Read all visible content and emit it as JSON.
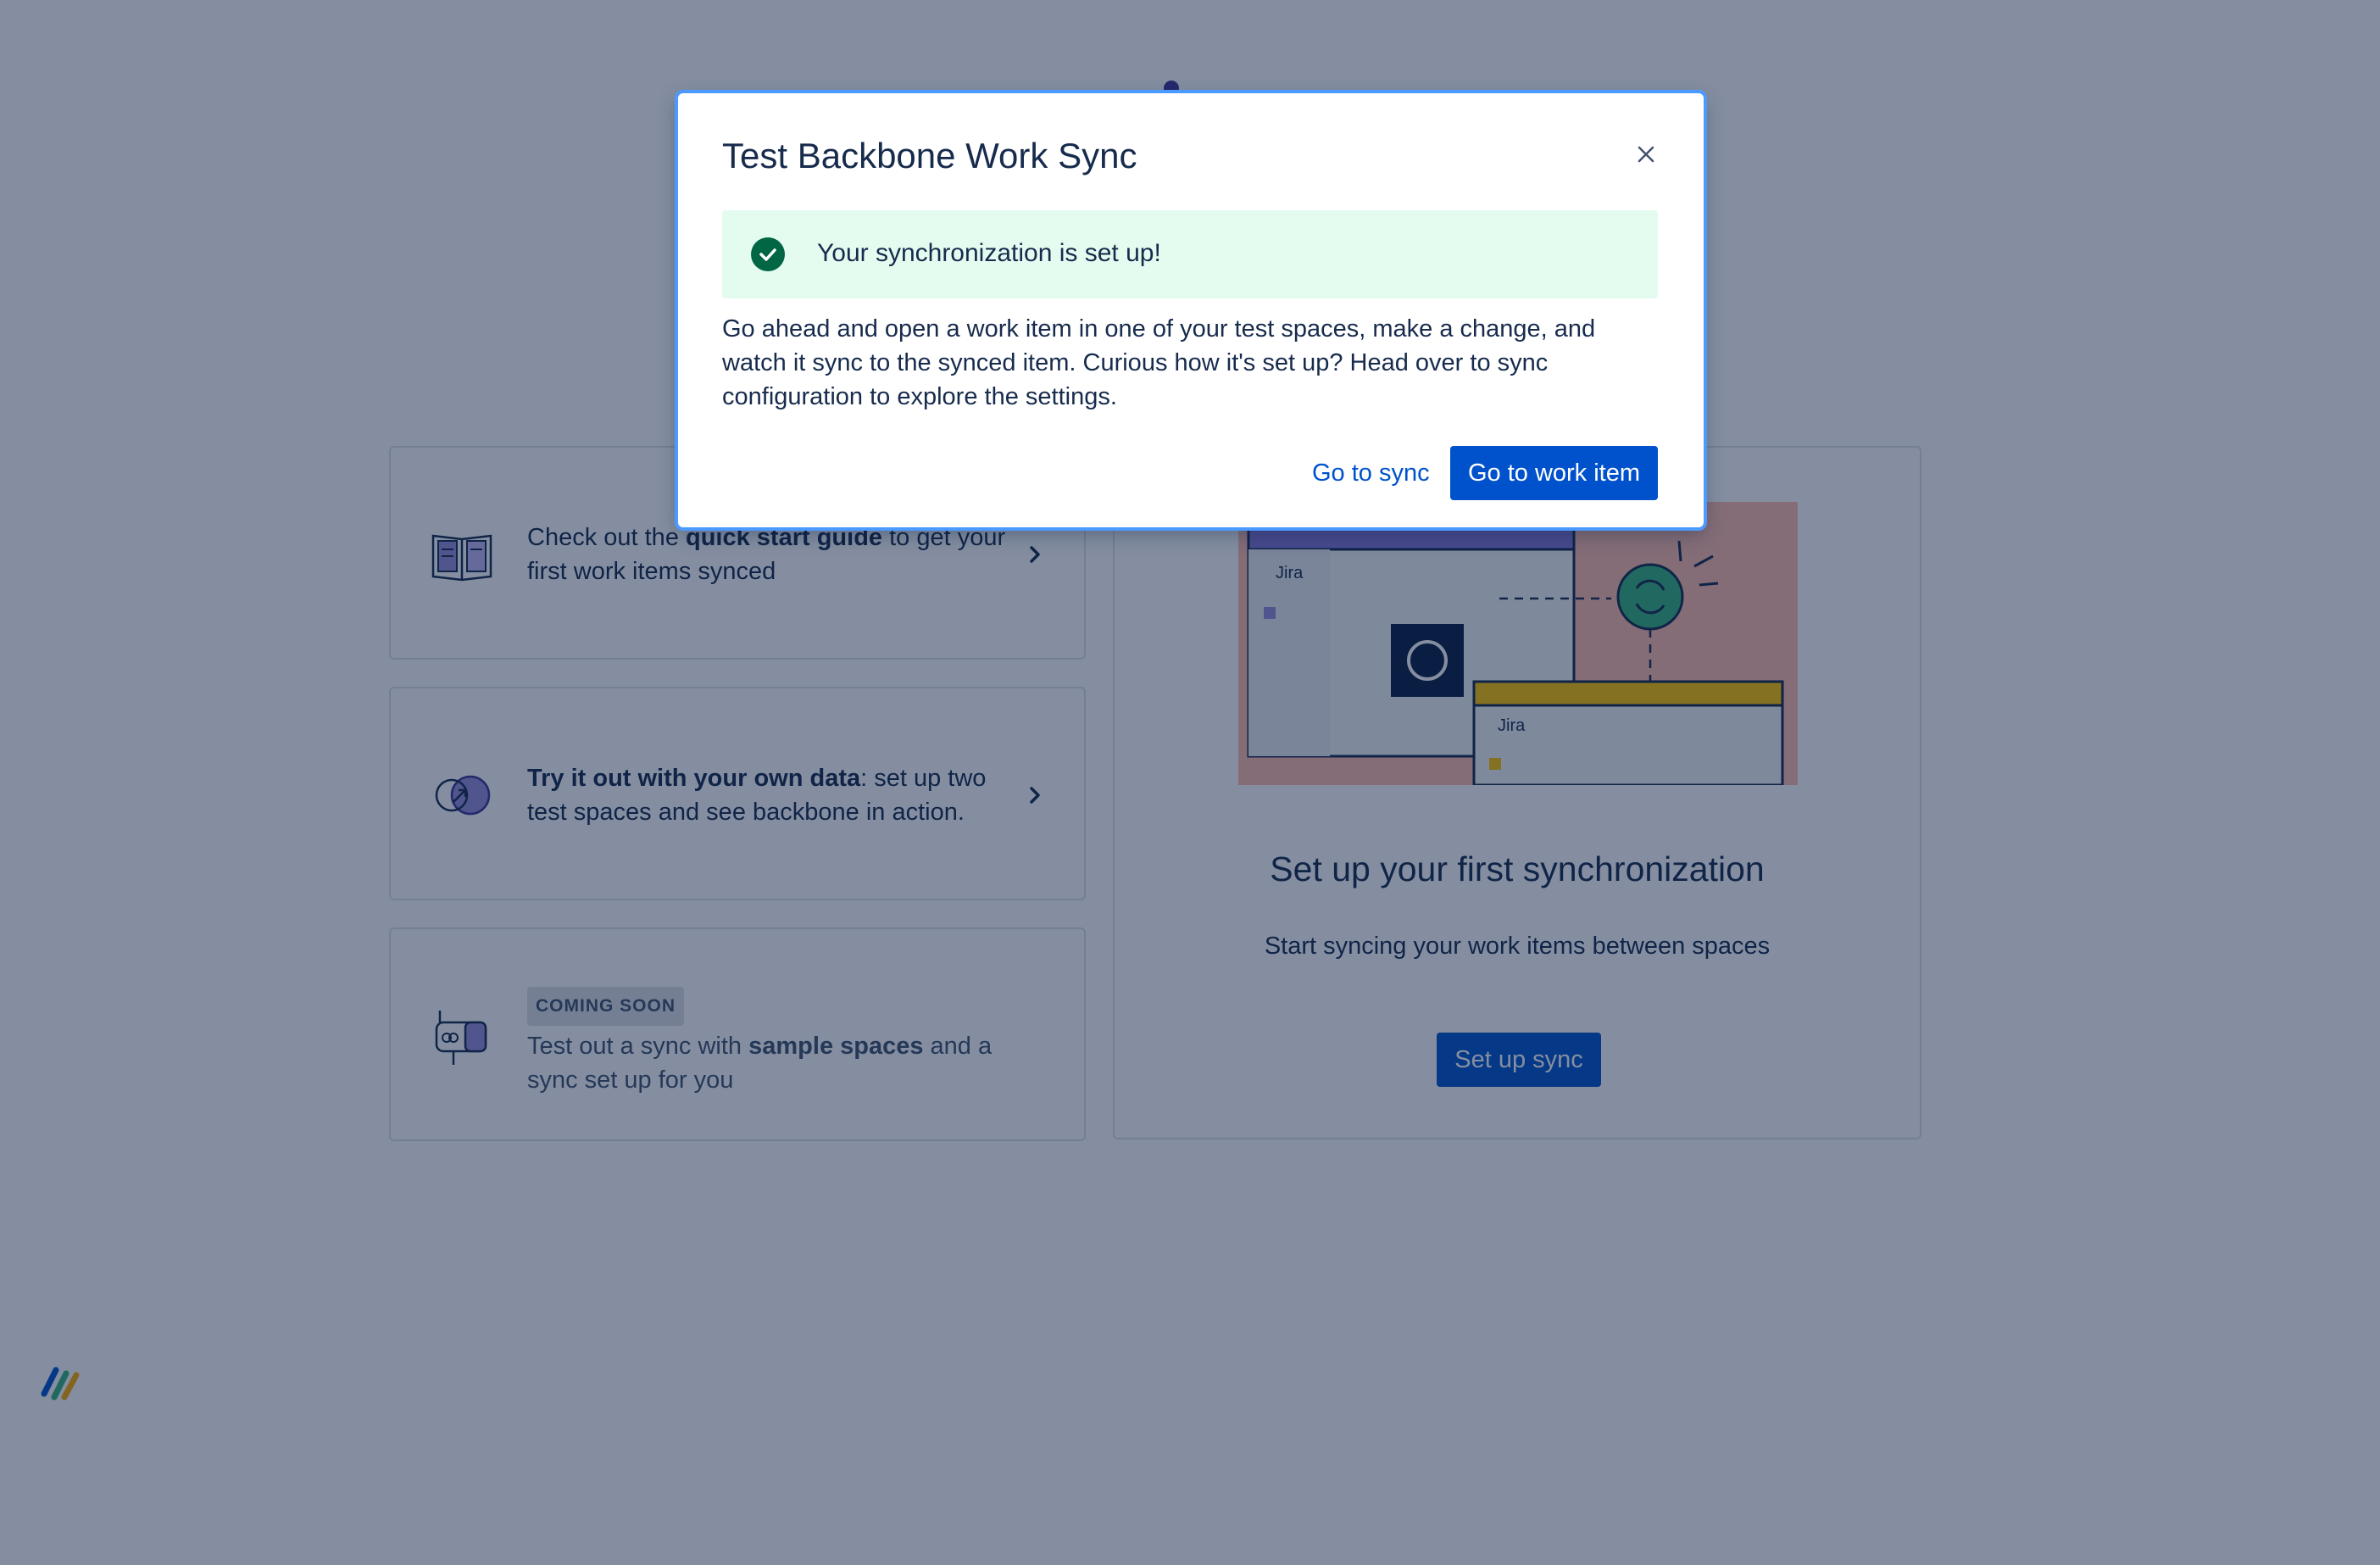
{
  "background": {
    "cards": [
      {
        "icon": "open-book-icon",
        "text_pre": "Check out the ",
        "text_bold": "quick start guide",
        "text_post": " to get your first work items synced"
      },
      {
        "icon": "sync-link-icon",
        "text_pre": "",
        "text_bold": "Try it out with your own data",
        "text_post": ": set up two test spaces and see backbone in action."
      },
      {
        "icon": "mailbox-icon",
        "badge": "COMING SOON",
        "text_pre": "Test out a sync with ",
        "text_bold": "sample spaces",
        "text_post": " and a sync set up for you"
      }
    ],
    "hero": {
      "jira_label_1": "Jira",
      "jira_label_2": "Jira",
      "title": "Set up your first synchronization",
      "subtitle": "Start syncing your work items between spaces",
      "button": "Set up sync"
    }
  },
  "modal": {
    "title": "Test Backbone Work Sync",
    "success_message": "Your synchronization is set up!",
    "body": "Go ahead and open a work item in one of your test spaces, make a change, and watch it sync to the synced item. Curious how it's set up? Head over to sync configuration to explore the settings.",
    "secondary_button": "Go to sync",
    "primary_button": "Go to work item"
  },
  "colors": {
    "primary": "#0052cc",
    "success_bg": "#e3fcef",
    "success_icon": "#006644",
    "overlay": "rgba(9,30,66,0.5)",
    "text": "#172b4d"
  }
}
